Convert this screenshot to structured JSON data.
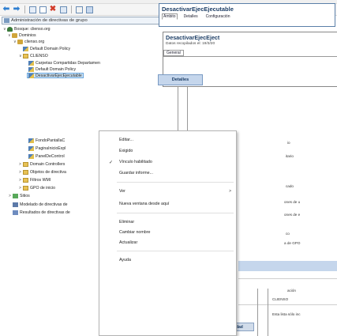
{
  "toolbar": {
    "buttons": [
      "back-icon",
      "forward-icon",
      "console-tree-icon",
      "properties-icon",
      "delete-icon",
      "refresh-icon",
      "help-icon",
      "show-hide-icon"
    ]
  },
  "tree": {
    "header": "Administración de directivas de grupo",
    "forest": "Bosque: clienso.org",
    "domains": "Dominios",
    "domain": "clienso.org",
    "default_policy": "Default Domain Policy",
    "ou_clienso": "CLIENSO",
    "shared_folders": "Carpetas Compartidas Departamen",
    "default_policy_2": "Default Domain Policy",
    "selected": "DesactivarEjecEjecutable",
    "fondo": "FondoPantallaC",
    "pagina": "PaginaInicioExpl",
    "panel": "PanelDeControl",
    "domain_controllers": "Domain Controllers",
    "gpo_objects": "Objetos de directiva",
    "wmi_filters": "Filtros WMI",
    "starter_gpos": "GPO de inicio",
    "sites": "Sitios",
    "modeling": "Modelado de directivas de",
    "results": "Resultados de directivas de"
  },
  "right": {
    "outer_title": "DesactivarEjecEjecutable",
    "outer_tabs": [
      "Ámbito",
      "Detalles",
      "Configuración"
    ],
    "inner_title": "DesactivarEjecEject",
    "inner_sub": "Datos recopilados el: 19/3/20",
    "inner_tab": "General",
    "details_button": "Detalles",
    "clipped": [
      "io",
      "itario",
      "cado",
      "ones de u",
      "ones de e",
      "co",
      "a de GPO",
      "ación",
      "CLIENSO",
      "Esta lista sólo inc"
    ],
    "filter_tab": "Filtrado de seguridad"
  },
  "context_menu": {
    "items": [
      {
        "label": "Editar...",
        "checked": false,
        "submenu": false
      },
      {
        "label": "Exigido",
        "checked": false,
        "submenu": false
      },
      {
        "label": "Vínculo habilitado",
        "checked": true,
        "submenu": false
      },
      {
        "label": "Guardar informe...",
        "checked": false,
        "submenu": false
      },
      {
        "label": "Ver",
        "checked": false,
        "submenu": true
      },
      {
        "label": "Nueva ventana desde aquí",
        "checked": false,
        "submenu": false
      },
      {
        "label": "Eliminar",
        "checked": false,
        "submenu": false
      },
      {
        "label": "Cambiar nombre",
        "checked": false,
        "submenu": false
      },
      {
        "label": "Actualizar",
        "checked": false,
        "submenu": false
      },
      {
        "label": "Ayuda",
        "checked": false,
        "submenu": false
      }
    ]
  },
  "colors": {
    "selection": "#cce4f7",
    "accent_blue": "#c5d6ec",
    "title_blue": "#1d3e66"
  }
}
